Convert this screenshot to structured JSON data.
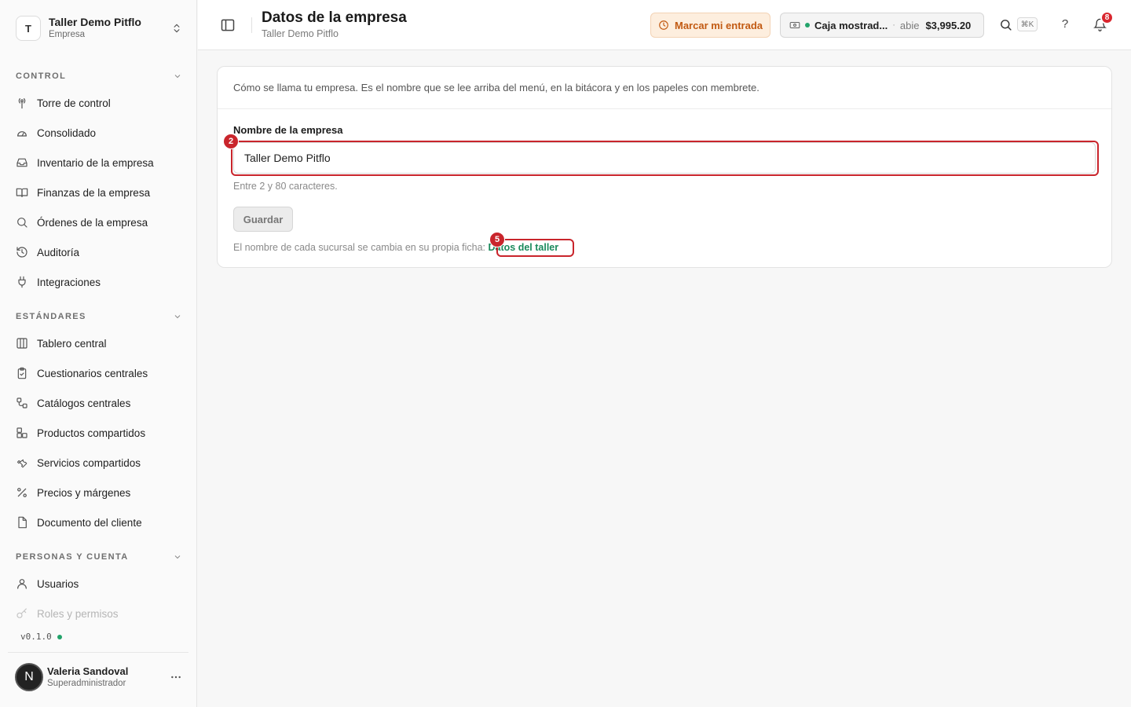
{
  "org": {
    "initial": "T",
    "name": "Taller Demo Pitflo",
    "sub": "Empresa"
  },
  "sections": [
    {
      "title": "CONTROL",
      "items": [
        {
          "label": "Torre de control",
          "icon": "tower-icon"
        },
        {
          "label": "Consolidado",
          "icon": "gauge-icon"
        },
        {
          "label": "Inventario de la empresa",
          "icon": "inbox-icon"
        },
        {
          "label": "Finanzas de la empresa",
          "icon": "book-icon"
        },
        {
          "label": "Órdenes de la empresa",
          "icon": "search-icon"
        },
        {
          "label": "Auditoría",
          "icon": "history-icon"
        },
        {
          "label": "Integraciones",
          "icon": "plug-icon"
        }
      ]
    },
    {
      "title": "ESTÁNDARES",
      "items": [
        {
          "label": "Tablero central",
          "icon": "columns-icon"
        },
        {
          "label": "Cuestionarios centrales",
          "icon": "clipboard-icon"
        },
        {
          "label": "Catálogos centrales",
          "icon": "workflow-icon"
        },
        {
          "label": "Productos compartidos",
          "icon": "boxes-icon"
        },
        {
          "label": "Servicios compartidos",
          "icon": "wrench-icon"
        },
        {
          "label": "Precios y márgenes",
          "icon": "percent-icon"
        },
        {
          "label": "Documento del cliente",
          "icon": "file-icon"
        }
      ]
    },
    {
      "title": "PERSONAS Y CUENTA",
      "items": [
        {
          "label": "Usuarios",
          "icon": "user-icon"
        },
        {
          "label": "Roles y permisos",
          "icon": "key-icon"
        }
      ]
    }
  ],
  "version": "v0.1.0",
  "user": {
    "initial": "N",
    "name": "Valeria Sandoval",
    "role": "Superadministrador"
  },
  "header": {
    "title": "Datos de la empresa",
    "subtitle": "Taller Demo Pitflo",
    "clock_label": "Marcar mi entrada",
    "cash_name": "Caja mostrad...",
    "cash_sep": "·",
    "cash_status": "abie",
    "cash_amount": "$3,995.20",
    "shortcut": "⌘K",
    "help": "?",
    "notifications": "8"
  },
  "form": {
    "description": "Cómo se llama tu empresa. Es el nombre que se lee arriba del menú, en la bitácora y en los papeles con membrete.",
    "label": "Nombre de la empresa",
    "value": "Taller Demo Pitflo",
    "hint": "Entre 2 y 80 caracteres.",
    "save_label": "Guardar",
    "footnote": "El nombre de cada sucursal se cambia en su propia ficha:",
    "link": "Datos del taller"
  },
  "annotations": {
    "input_badge": "2",
    "link_badge": "5",
    "color": "#c9252c"
  },
  "colors": {
    "accent_link": "#1a8a5c",
    "clock_bg": "#fdeede",
    "clock_text": "#c25a12",
    "status_dot": "#22a36a",
    "badge": "#d9262e"
  }
}
